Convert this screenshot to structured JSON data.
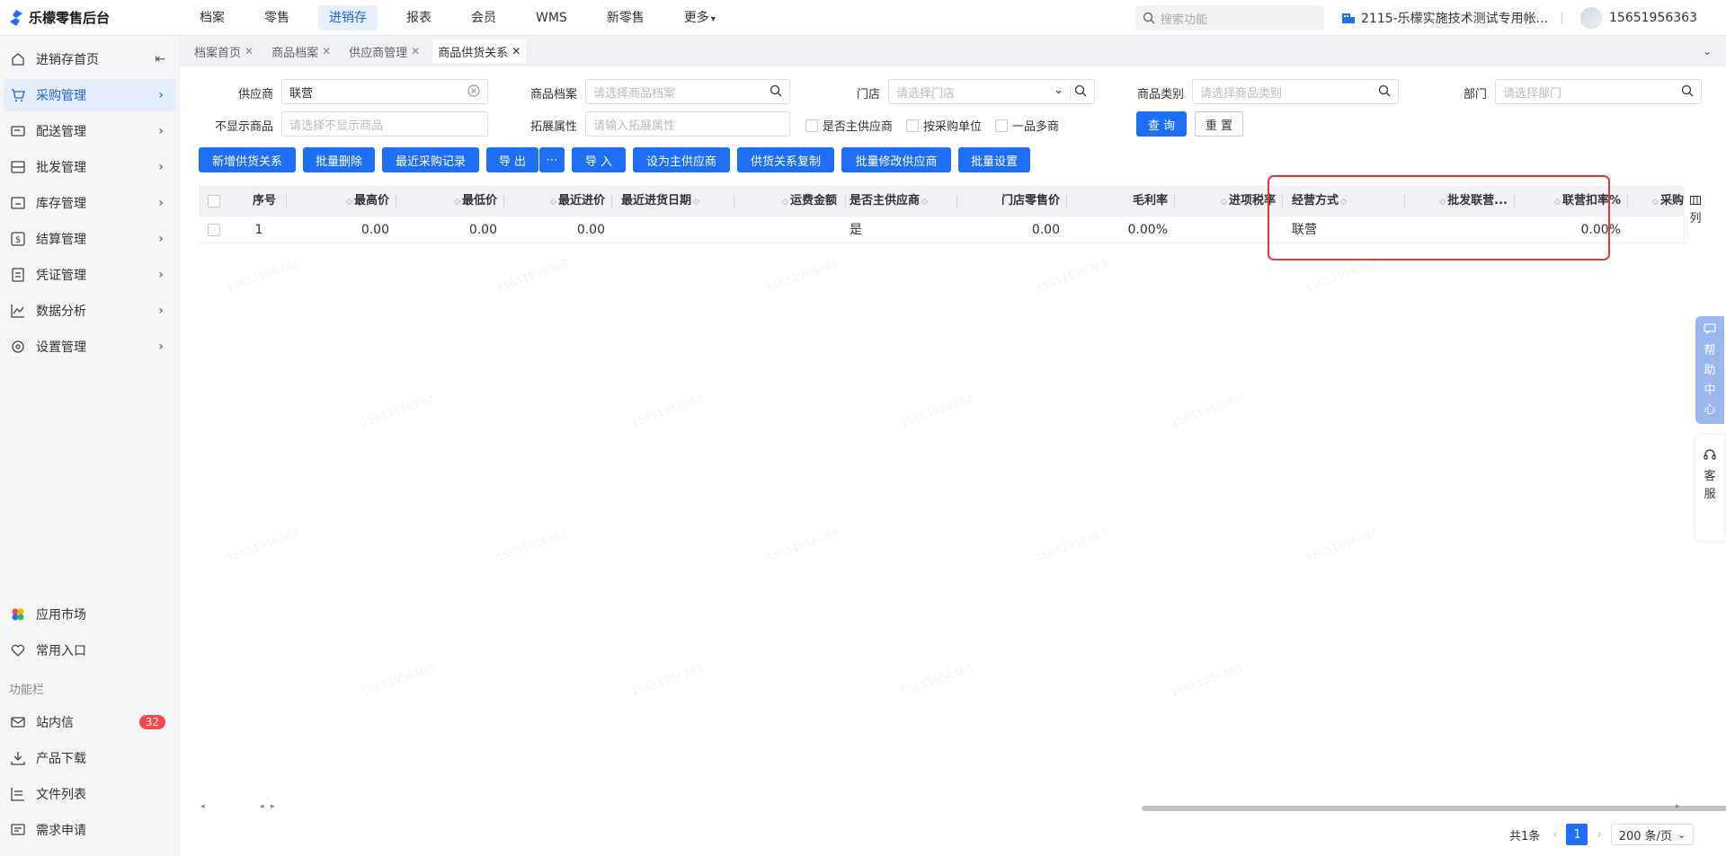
{
  "app": {
    "title": "乐檬零售后台"
  },
  "topnav": [
    "档案",
    "零售",
    "进销存",
    "报表",
    "会员",
    "WMS",
    "新零售",
    "更多"
  ],
  "topnav_active": "进销存",
  "search": {
    "placeholder": "搜索功能"
  },
  "store": {
    "name": "2115-乐檬实施技术测试专用帐..."
  },
  "user": {
    "phone": "15651956363"
  },
  "sidebar": {
    "items": [
      {
        "label": "进销存首页"
      },
      {
        "label": "采购管理"
      },
      {
        "label": "配送管理"
      },
      {
        "label": "批发管理"
      },
      {
        "label": "库存管理"
      },
      {
        "label": "结算管理"
      },
      {
        "label": "凭证管理"
      },
      {
        "label": "数据分析"
      },
      {
        "label": "设置管理"
      }
    ],
    "bottom": [
      {
        "label": "应用市场"
      },
      {
        "label": "常用入口"
      }
    ],
    "section_label": "功能栏",
    "func": [
      {
        "label": "站内信",
        "badge": "32"
      },
      {
        "label": "产品下载"
      },
      {
        "label": "文件列表"
      },
      {
        "label": "需求申请"
      }
    ]
  },
  "tabs": [
    {
      "label": "档案首页"
    },
    {
      "label": "商品档案"
    },
    {
      "label": "供应商管理"
    },
    {
      "label": "商品供货关系"
    }
  ],
  "filters": {
    "supplier": {
      "label": "供应商",
      "value": "联营"
    },
    "goods": {
      "label": "商品档案",
      "placeholder": "请选择商品档案"
    },
    "store": {
      "label": "门店",
      "placeholder": "请选择门店"
    },
    "category": {
      "label": "商品类别",
      "placeholder": "请选择商品类别"
    },
    "dept": {
      "label": "部门",
      "placeholder": "请选择部门"
    },
    "hide": {
      "label": "不显示商品",
      "placeholder": "请选择不显示商品"
    },
    "ext": {
      "label": "拓展属性",
      "placeholder": "请输入拓展属性"
    },
    "checks": [
      "是否主供应商",
      "按采购单位",
      "一品多商"
    ],
    "query": "查 询",
    "reset": "重 置"
  },
  "actions": [
    "新增供货关系",
    "批量删除",
    "最近采购记录",
    "导 出",
    "导 入",
    "设为主供应商",
    "供货关系复制",
    "批量修改供应商",
    "批量设置"
  ],
  "table": {
    "headers": [
      "序号",
      "最高价",
      "最低价",
      "最近进价",
      "最近进货日期",
      "运费金额",
      "是否主供应商",
      "门店零售价",
      "毛利率",
      "进项税率",
      "经营方式",
      "批发联营...",
      "联营扣率%",
      "采购"
    ],
    "rows": [
      {
        "no": "1",
        "max": "0.00",
        "min": "0.00",
        "recent": "0.00",
        "date": "",
        "freight": "",
        "main": "是",
        "retail": "0.00",
        "margin": "0.00%",
        "tax": "",
        "mode": "联营",
        "wholesale": "",
        "rate": "0.00%"
      }
    ]
  },
  "colset": "列",
  "help": [
    "帮",
    "助",
    "中",
    "心"
  ],
  "service": [
    "客",
    "服"
  ],
  "pager": {
    "total": "共1条",
    "page": "1",
    "size": "200 条/页"
  },
  "watermark": "15651956363"
}
